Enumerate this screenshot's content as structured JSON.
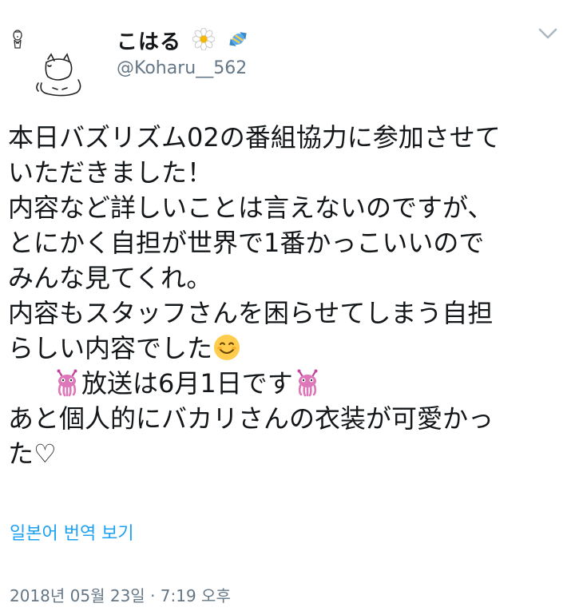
{
  "tweet": {
    "display_name": "こはる",
    "handle": "@Koharu__562",
    "lines": {
      "l1": "本日バズリズム02の番組協力に参加させて",
      "l2": "いただきました！",
      "l3": "内容など詳しいことは言えないのですが、",
      "l4": "とにかく自担が世界で1番かっこいいので",
      "l5": "みんな見てくれ。",
      "l6": "内容もスタッフさんを困らせてしまう自担",
      "l7": "らしい内容でした",
      "l8": "放送は6月1日です",
      "l9": "あと個人的にバカリさんの衣装が可愛かっ",
      "l10": "た♡"
    },
    "translate_link": "일본어 번역 보기",
    "timestamp": "2018년 05월 23일 · 7:19 오후"
  },
  "icons": {
    "name_icons": [
      "daisy-icon",
      "candy-icon"
    ],
    "emoji_line7": "smiling-face-icon",
    "emoji_line8": "alien-monster-icon",
    "menu": "chevron-down-icon"
  },
  "colors": {
    "link": "#1da1f2",
    "secondary_text": "#657786",
    "primary_text": "#14171a"
  }
}
